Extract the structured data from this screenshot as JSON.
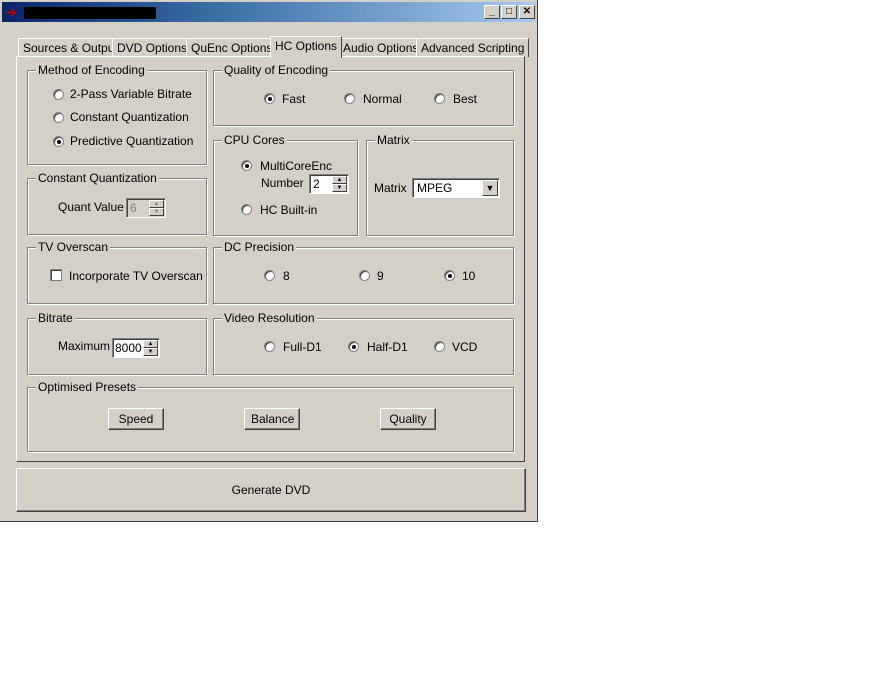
{
  "window": {
    "title": ""
  },
  "titlebar": {
    "minimize": "_",
    "maximize": "□",
    "close": "✕"
  },
  "tabs": [
    {
      "label": "Sources & Output"
    },
    {
      "label": "DVD Options"
    },
    {
      "label": "QuEnc Options"
    },
    {
      "label": "HC Options",
      "active": true
    },
    {
      "label": "Audio Options"
    },
    {
      "label": "Advanced Scripting"
    }
  ],
  "method_of_encoding": {
    "title": "Method of Encoding",
    "options": [
      "2-Pass Variable Bitrate",
      "Constant Quantization",
      "Predictive Quantization"
    ],
    "selected": "Predictive Quantization"
  },
  "quality_of_encoding": {
    "title": "Quality of Encoding",
    "options": [
      "Fast",
      "Normal",
      "Best"
    ],
    "selected": "Fast"
  },
  "constant_quantization": {
    "title": "Constant Quantization",
    "quant_label": "Quant Value",
    "quant_value": "6"
  },
  "cpu_cores": {
    "title": "CPU Cores",
    "multicore_label": "MultiCoreEnc",
    "number_label": "Number",
    "number_value": "2",
    "builtin_label": "HC Built-in",
    "selected": "MultiCoreEnc"
  },
  "matrix": {
    "title": "Matrix",
    "label": "Matrix",
    "value": "MPEG"
  },
  "tv_overscan": {
    "title": "TV Overscan",
    "checkbox_label": "Incorporate TV Overscan",
    "checked": false
  },
  "dc_precision": {
    "title": "DC Precision",
    "options": [
      "8",
      "9",
      "10"
    ],
    "selected": "10"
  },
  "bitrate": {
    "title": "Bitrate",
    "max_label": "Maximum",
    "max_value": "8000"
  },
  "video_resolution": {
    "title": "Video Resolution",
    "options": [
      "Full-D1",
      "Half-D1",
      "VCD"
    ],
    "selected": "Half-D1"
  },
  "presets": {
    "title": "Optimised Presets",
    "speed": "Speed",
    "balance": "Balance",
    "quality": "Quality"
  },
  "generate_button": "Generate DVD",
  "colors": {
    "face": "#d4d0c8",
    "title_start": "#0a246a",
    "title_end": "#a6caf0"
  }
}
